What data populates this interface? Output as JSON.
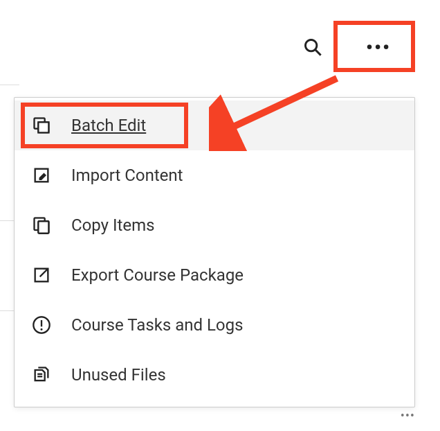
{
  "toolbar": {
    "search_title": "Search",
    "more_title": "More options"
  },
  "menu": {
    "items": [
      {
        "icon": "copy-edit-icon",
        "label": "Batch Edit",
        "highlight": true
      },
      {
        "icon": "edit-in-icon",
        "label": "Import Content"
      },
      {
        "icon": "copy-icon",
        "label": "Copy Items"
      },
      {
        "icon": "export-icon",
        "label": "Export Course Package"
      },
      {
        "icon": "alert-icon",
        "label": "Course Tasks and Logs"
      },
      {
        "icon": "files-icon",
        "label": "Unused Files"
      }
    ]
  },
  "annotation": {
    "color": "#f54125"
  }
}
